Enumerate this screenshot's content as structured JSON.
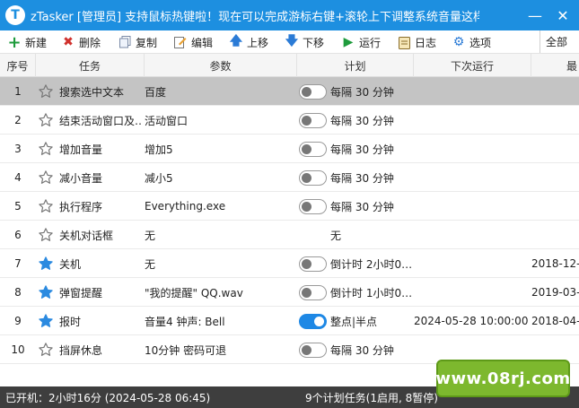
{
  "window": {
    "logo": "T",
    "title": "zTasker [管理员]   支持鼠标热键啦！现在可以完成游标右键+滚轮上下调整系统音量这样",
    "minimize": "—",
    "close": "✕"
  },
  "toolbar": {
    "new": "新建",
    "delete": "删除",
    "copy": "复制",
    "edit": "编辑",
    "move_up": "上移",
    "move_down": "下移",
    "run": "运行",
    "log": "日志",
    "options": "选项",
    "filter": "全部"
  },
  "columns": {
    "no": "序号",
    "task": "任务",
    "param": "参数",
    "plan": "计划",
    "next": "下次运行",
    "last": "最"
  },
  "rows": [
    {
      "no": "1",
      "task": "搜索选中文本",
      "param": "百度",
      "plan": "每隔 30 分钟",
      "next": "",
      "last": "",
      "fav": false,
      "toggle": true,
      "on": false
    },
    {
      "no": "2",
      "task": "结束活动窗口及…",
      "param": "活动窗口",
      "plan": "每隔 30 分钟",
      "next": "",
      "last": "",
      "fav": false,
      "toggle": true,
      "on": false
    },
    {
      "no": "3",
      "task": "增加音量",
      "param": "增加5",
      "plan": "每隔 30 分钟",
      "next": "",
      "last": "",
      "fav": false,
      "toggle": true,
      "on": false
    },
    {
      "no": "4",
      "task": "减小音量",
      "param": "减小5",
      "plan": "每隔 30 分钟",
      "next": "",
      "last": "",
      "fav": false,
      "toggle": true,
      "on": false
    },
    {
      "no": "5",
      "task": "执行程序",
      "param": "Everything.exe",
      "plan": "每隔 30 分钟",
      "next": "",
      "last": "",
      "fav": false,
      "toggle": true,
      "on": false
    },
    {
      "no": "6",
      "task": "关机对话框",
      "param": "无",
      "plan": "无",
      "next": "",
      "last": "",
      "fav": false,
      "toggle": false,
      "on": false
    },
    {
      "no": "7",
      "task": "关机",
      "param": "无",
      "plan": "倒计时 2小时0…",
      "next": "",
      "last": "2018-12-",
      "fav": true,
      "toggle": true,
      "on": false
    },
    {
      "no": "8",
      "task": "弹窗提醒",
      "param": "\"我的提醒\" QQ.wav",
      "plan": "倒计时 1小时0…",
      "next": "",
      "last": "2019-03-",
      "fav": true,
      "toggle": true,
      "on": false
    },
    {
      "no": "9",
      "task": "报时",
      "param": "音量4 钟声: Bell",
      "plan": "整点|半点",
      "next": "2024-05-28 10:00:00",
      "last": "2018-04-",
      "fav": true,
      "toggle": true,
      "on": true
    },
    {
      "no": "10",
      "task": "挡屏休息",
      "param": "10分钟 密码可退",
      "plan": "每隔 30 分钟",
      "next": "",
      "last": "",
      "fav": false,
      "toggle": true,
      "on": false
    }
  ],
  "status": {
    "left": "已开机：2小时16分 (2024-05-28 06:45)",
    "right": "9个计划任务(1启用, 8暂停)"
  },
  "watermark": "www.08rj.com",
  "colors": {
    "title_bar": "#1d8fe0",
    "selected_row": "#c4c4c4",
    "star_fav": "#2b8ae0",
    "toggle_on": "#1e88e5",
    "status_bar": "#3e3e3e",
    "watermark_bg": "#7db82e"
  },
  "icons": {
    "new": "plus-icon",
    "delete": "x-icon",
    "copy": "copy-icon",
    "edit": "edit-icon",
    "move_up": "arrow-up-icon",
    "move_down": "arrow-down-icon",
    "run": "play-icon",
    "log": "log-icon",
    "options": "gear-icon",
    "star": "star-icon"
  }
}
